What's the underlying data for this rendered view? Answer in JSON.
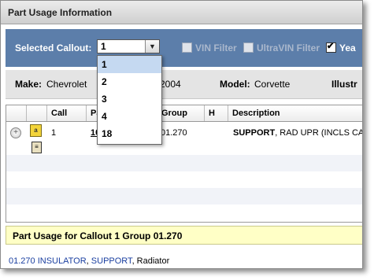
{
  "window": {
    "title": "Part Usage Information"
  },
  "toolbar": {
    "callout_label": "Selected Callout:",
    "callout_value": "1",
    "vin_filter_label": "VIN Filter",
    "ultravin_filter_label": "UltraVIN Filter",
    "year_label": "Yea",
    "year_checked": true
  },
  "dropdown": {
    "options": [
      "1",
      "2",
      "3",
      "4",
      "18"
    ],
    "selected": "1"
  },
  "info": {
    "make_label": "Make:",
    "make_value": "Chevrolet",
    "year_value": "2004",
    "model_label": "Model:",
    "model_value": "Corvette",
    "illustr_label": "Illustr"
  },
  "grid": {
    "headers": {
      "call": "Call",
      "part": "Pa",
      "group": "Group",
      "h": "H",
      "description": "Description"
    },
    "rows": [
      {
        "call": "1",
        "part": "10",
        "group": "01.270",
        "description_bold": "SUPPORT",
        "description_rest": ", RAD UPR (INCLS CAU"
      }
    ]
  },
  "footer": {
    "text": "Part Usage for Callout 1 Group 01.270"
  },
  "parts_line": {
    "group": "01.270",
    "item1": "INSULATOR",
    "sep": ",",
    "item2": "SUPPORT",
    "rest": ", Radiator"
  }
}
